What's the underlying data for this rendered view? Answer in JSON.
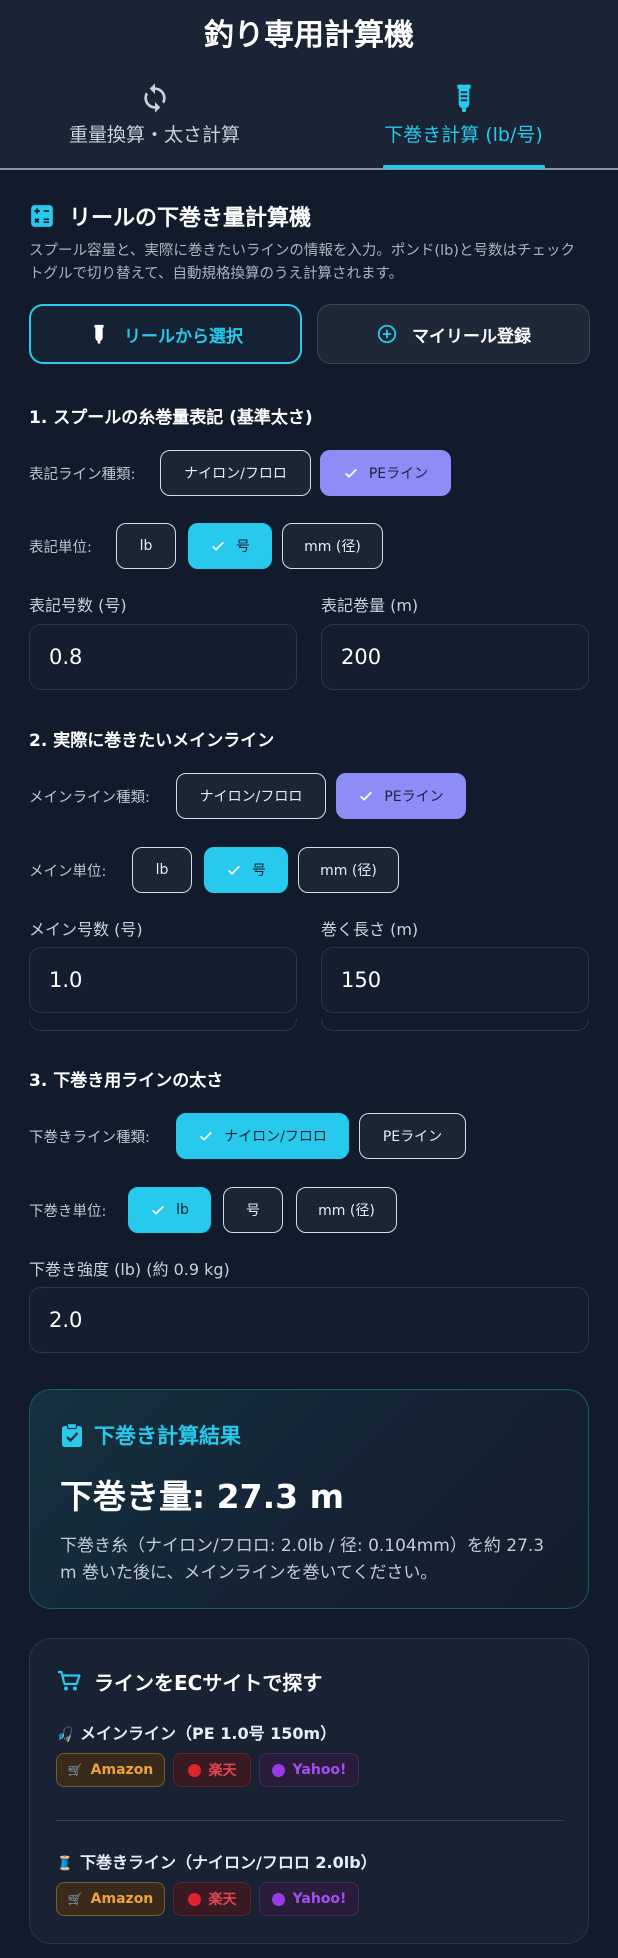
{
  "app": {
    "title": "釣り専用計算機"
  },
  "tabs": [
    {
      "label": "重量換算・太さ計算",
      "icon": "sync-icon",
      "active": false
    },
    {
      "label": "下巻き計算 (lb/号)",
      "icon": "spool-icon",
      "active": true
    }
  ],
  "calculator": {
    "title": "リールの下巻き量計算機",
    "description": "スプール容量と、実際に巻きたいラインの情報を入力。ポンド(lb)と号数はチェックトグルで切り替えて、自動規格換算のうえ計算されます。",
    "select_reel_label": "リールから選択",
    "register_reel_label": "マイリール登録"
  },
  "spool_spec": {
    "section_title": "1. スプールの糸巻量表記 (基準太さ)",
    "line_type_label": "表記ライン種類:",
    "line_types": [
      "ナイロン/フロロ",
      "PEライン"
    ],
    "line_type_selected": "PEライン",
    "unit_label": "表記単位:",
    "units": [
      "lb",
      "号",
      "mm (径)"
    ],
    "unit_selected": "号",
    "size_label": "表記号数 (号)",
    "size_value": "0.8",
    "length_label": "表記巻量 (m)",
    "length_value": "200"
  },
  "main_line": {
    "section_title": "2. 実際に巻きたいメインライン",
    "line_type_label": "メインライン種類:",
    "line_types": [
      "ナイロン/フロロ",
      "PEライン"
    ],
    "line_type_selected": "PEライン",
    "unit_label": "メイン単位:",
    "units": [
      "lb",
      "号",
      "mm (径)"
    ],
    "unit_selected": "号",
    "size_label": "メイン号数 (号)",
    "size_value": "1.0",
    "length_label": "巻く長さ (m)",
    "length_value": "150"
  },
  "backing_line": {
    "section_title": "3. 下巻き用ラインの太さ",
    "line_type_label": "下巻きライン種類:",
    "line_types": [
      "ナイロン/フロロ",
      "PEライン"
    ],
    "line_type_selected": "ナイロン/フロロ",
    "unit_label": "下巻き単位:",
    "units": [
      "lb",
      "号",
      "mm (径)"
    ],
    "unit_selected": "lb",
    "strength_label": "下巻き強度 (lb) (約 0.9 kg)",
    "strength_value": "2.0"
  },
  "result": {
    "title": "下巻き計算結果",
    "amount": "下巻き量: 27.3 m",
    "description": "下巻き糸（ナイロン/フロロ: 2.0lb / 径: 0.104mm）を約 27.3 m 巻いた後に、メインラインを巻いてください。"
  },
  "ec": {
    "title": "ラインをECサイトで探す",
    "main_line_label": "メインライン（PE 1.0号 150m）",
    "main_line_emoji": "🎣",
    "backing_line_label": "下巻きライン（ナイロン/フロロ 2.0lb）",
    "backing_line_emoji": "🧵",
    "shops": {
      "amazon": "Amazon",
      "amazon_emoji": "🛒",
      "rakuten": "楽天",
      "yahoo": "Yahoo!"
    }
  },
  "colors": {
    "accent": "#27c9ec",
    "selected_purple": "#8c8df6",
    "background": "#111b2b",
    "amazon": "#f0a23a",
    "rakuten": "#e4464f",
    "yahoo": "#a44ff0"
  }
}
